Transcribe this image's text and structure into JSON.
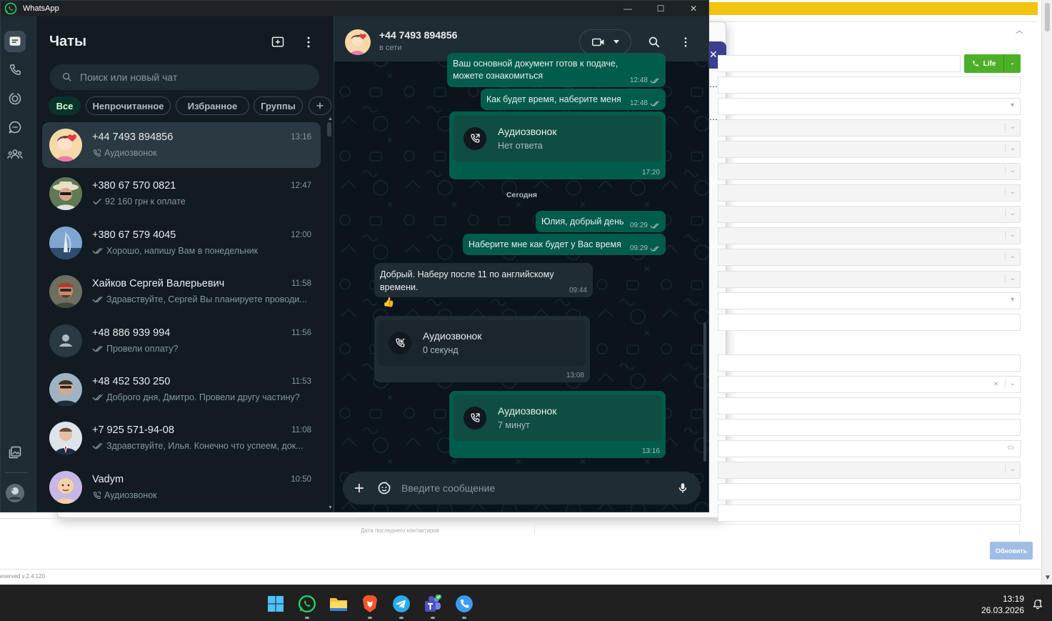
{
  "background_app": {
    "life_button_label": "Life",
    "update_button_label": "Обновить",
    "footer_text": "eserved v.2.4.120",
    "below_text": "Дата последнего контактиров"
  },
  "window": {
    "title": "WhatsApp",
    "minimize": "—",
    "maximize": "☐",
    "close": "✕"
  },
  "sidebar_rail": {
    "items": [
      {
        "icon": "chats-icon",
        "active": true
      },
      {
        "icon": "calls-icon"
      },
      {
        "icon": "status-icon"
      },
      {
        "icon": "channels-icon"
      },
      {
        "icon": "communities-icon"
      }
    ],
    "bottom": [
      {
        "icon": "media-icon"
      },
      {
        "icon": "profile-avatar"
      }
    ]
  },
  "chat_list": {
    "title": "Чаты",
    "search_placeholder": "Поиск или новый чат",
    "filters": [
      "Все",
      "Непрочитанное",
      "Избранное",
      "Группы"
    ],
    "add_filter": "+",
    "chats": [
      {
        "name": "+44 7493 894856",
        "time": "13:16",
        "preview": "Аудиозвонок",
        "status": "call",
        "selected": true
      },
      {
        "name": "+380 67 570 0821",
        "time": "12:47",
        "preview": "92 160 грн к оплате",
        "status": "sent"
      },
      {
        "name": "+380 67 579 4045",
        "time": "12:00",
        "preview": "Хорошо, напишу Вам в понедельник",
        "status": "read"
      },
      {
        "name": "Хайков Сергей Валерьевич",
        "time": "11:58",
        "preview": "Здравствуйте, Сергей Вы планируете проводи...",
        "status": "read"
      },
      {
        "name": "+48 886 939 994",
        "time": "11:56",
        "preview": "Провели оплату?",
        "status": "read"
      },
      {
        "name": "+48 452 530 250",
        "time": "11:53",
        "preview": "Доброго дня, Дмитро. Провели другу частину?",
        "status": "read"
      },
      {
        "name": "+7 925 571-94-08",
        "time": "11:08",
        "preview": "Здравствуйте, Илья. Конечно что успеем, док...",
        "status": "read"
      },
      {
        "name": "Vadym",
        "time": "10:50",
        "preview": "Аудиозвонок",
        "status": "call"
      }
    ]
  },
  "conversation": {
    "contact_name": "+44 7493 894856",
    "contact_status": "в сети",
    "messages": {
      "m1_line1": "Ваш основной документ готов к подаче,",
      "m1_line2": "можете ознакомиться",
      "m1_time": "12:48",
      "m2_text": "Как будет время, наберите меня",
      "m2_time": "12:48",
      "call1_title": "Аудиозвонок",
      "call1_sub": "Нет ответа",
      "call1_time": "17:20",
      "date_divider": "Сегодня",
      "m3_text": "Юлия, добрый день",
      "m3_time": "09:29",
      "m4_text": "Наберите мне как будет у Вас время",
      "m4_time": "09:29",
      "m5_line1": "Добрый. Наберу после 11 по английскому",
      "m5_line2": "времени.",
      "m5_time": "09:44",
      "m5_reaction": "👍",
      "call2_title": "Аудиозвонок",
      "call2_sub": "0 секунд",
      "call2_time": "13:08",
      "call3_title": "Аудиозвонок",
      "call3_sub": "7 минут",
      "call3_time": "13:16"
    },
    "composer_placeholder": "Введите сообщение"
  },
  "taskbar": {
    "apps": [
      "windows-start-icon",
      "whatsapp-icon",
      "file-explorer-icon",
      "brave-icon",
      "telegram-icon",
      "teams-icon",
      "phone-app-icon"
    ],
    "clock_time": "13:19",
    "clock_date": "26.03.2026"
  },
  "colors": {
    "wa_bg": "#111b21",
    "outgoing_bubble": "#005c4b",
    "incoming_bubble": "#202c33",
    "accent_green": "#00a884",
    "bg_yellow": "#f1c40f",
    "life_green": "#4caf28"
  }
}
